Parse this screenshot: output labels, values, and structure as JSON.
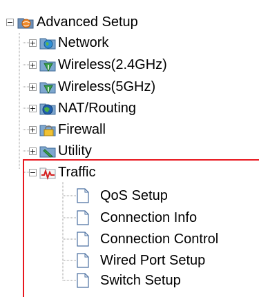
{
  "tree": {
    "root": {
      "label": "Advanced Setup",
      "icon": "folder-globe-icon",
      "expanded": true
    },
    "groups": [
      {
        "label": "Network",
        "icon": "network-globe-icon",
        "expanded": false
      },
      {
        "label": "Wireless(2.4GHz)",
        "icon": "wireless-antenna-icon",
        "expanded": false
      },
      {
        "label": "Wireless(5GHz)",
        "icon": "wireless-antenna-icon",
        "expanded": false
      },
      {
        "label": "NAT/Routing",
        "icon": "routing-globe-icon",
        "expanded": false
      },
      {
        "label": "Firewall",
        "icon": "firewall-lock-icon",
        "expanded": false
      },
      {
        "label": "Utility",
        "icon": "utility-pen-icon",
        "expanded": false
      },
      {
        "label": "Traffic",
        "icon": "traffic-chart-icon",
        "expanded": true
      }
    ],
    "traffic_children": [
      {
        "label": "QoS Setup",
        "icon": "page-icon"
      },
      {
        "label": "Connection Info",
        "icon": "page-icon"
      },
      {
        "label": "Connection Control",
        "icon": "page-icon"
      },
      {
        "label": "Wired Port Setup",
        "icon": "page-icon"
      },
      {
        "label": "Switch Setup",
        "icon": "page-icon"
      }
    ]
  },
  "colors": {
    "highlight_border": "#e8171f",
    "tree_line": "#9a9a9a"
  },
  "expander_symbols": {
    "collapsed": "+",
    "expanded": "−"
  }
}
